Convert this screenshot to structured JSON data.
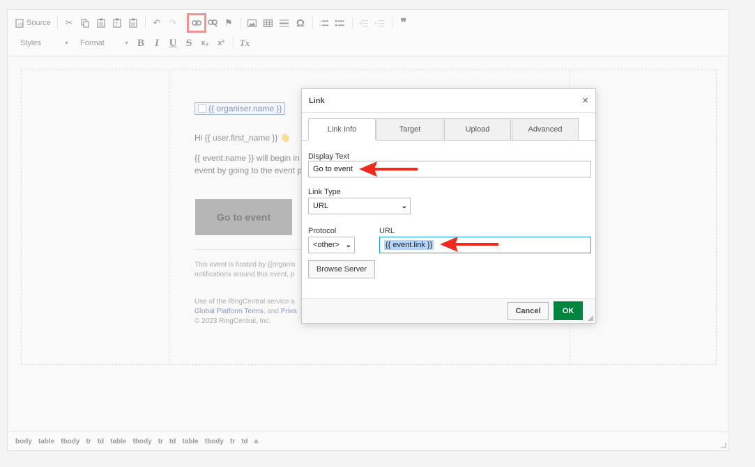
{
  "toolbar": {
    "source_label": "Source",
    "styles_label": "Styles",
    "format_label": "Format",
    "bold": "B",
    "italic": "I",
    "underline": "U",
    "strike": "S",
    "subscript": "x₂",
    "superscript": "x²",
    "remove_format": "Tx",
    "special_char": "Ω",
    "blockquote": "❞"
  },
  "email": {
    "logo_alt": "{{ organiser.name }}",
    "greeting": "Hi {{ user.first_name }} 👋",
    "line1": "{{ event.name }} will begin in l",
    "line2": "event by going to the event pa",
    "button_label": "Go to event",
    "hosted1": "This event is hosted by {{organis",
    "hosted2": "notifications around this event, p",
    "use1": "Use of the RingCentral service a",
    "use2_link": "Global Platform Terms",
    "use2_mid": ", and ",
    "use2_link2": "Priva",
    "copyright": "© 2023 RingCentral, Inc."
  },
  "path_bar": [
    "body",
    "table",
    "tbody",
    "tr",
    "td",
    "table",
    "tbody",
    "tr",
    "td",
    "table",
    "tbody",
    "tr",
    "td",
    "a"
  ],
  "dialog": {
    "title": "Link",
    "close": "×",
    "tabs": [
      "Link Info",
      "Target",
      "Upload",
      "Advanced"
    ],
    "display_text_label": "Display Text",
    "display_text_value": "Go to event",
    "link_type_label": "Link Type",
    "link_type_value": "URL",
    "protocol_label": "Protocol",
    "protocol_value": "<other>",
    "url_label": "URL",
    "url_value": "{{ event.link }}",
    "browse_label": "Browse Server",
    "cancel_label": "Cancel",
    "ok_label": "OK"
  },
  "colors": {
    "highlight": "#e53935",
    "ok_button": "#00843e",
    "focus_border": "#139ff7",
    "annotation_arrow": "#f02b1d"
  }
}
